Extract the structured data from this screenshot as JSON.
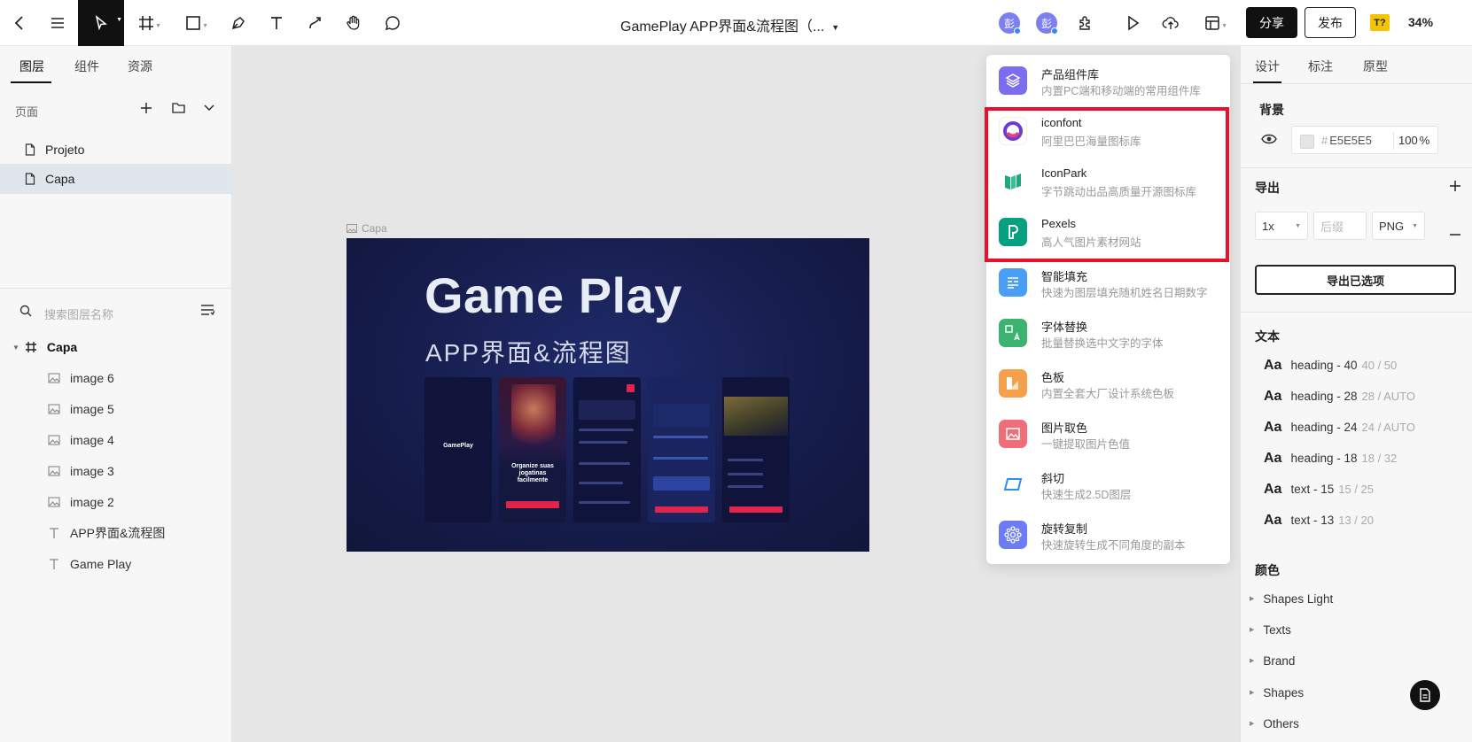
{
  "topbar": {
    "doc_title": "GamePlay APP界面&流程图（...",
    "avatar1": "彭",
    "avatar2": "彭",
    "share_label": "分享",
    "publish_label": "发布",
    "tq_badge": "T?",
    "zoom": "34%"
  },
  "left": {
    "tabs": [
      "图层",
      "组件",
      "资源"
    ],
    "pages_header": "页面",
    "pages": [
      "Projeto",
      "Capa"
    ],
    "search_placeholder": "搜索图层名称",
    "frame_name": "Capa",
    "layers": [
      "image 6",
      "image 5",
      "image 4",
      "image 3",
      "image 2",
      "APP界面&流程图",
      "Game Play"
    ]
  },
  "canvas": {
    "frame_label": "Capa",
    "title": "Game Play",
    "subtitle": "APP界面&流程图",
    "phone1_logo": "GamePlay",
    "phone2_text": "Organize suas jogatinas facilmente"
  },
  "plugins": [
    {
      "name": "产品组件库",
      "desc": "内置PC端和移动端的常用组件库",
      "icon": "layers-icon",
      "color": "#7b6cf0"
    },
    {
      "name": "iconfont",
      "desc": "阿里巴巴海量图标库",
      "icon": "iconfont-icon",
      "color": "#ffffff"
    },
    {
      "name": "IconPark",
      "desc": "字节跳动出品高质量开源图标库",
      "icon": "iconpark-icon",
      "color": "#ffffff"
    },
    {
      "name": "Pexels",
      "desc": "高人气图片素材网站",
      "icon": "pexels-icon",
      "color": "#05a081"
    },
    {
      "name": "智能填充",
      "desc": "快速为图层填充随机姓名日期数字",
      "icon": "fill-icon",
      "color": "#4a9ff5"
    },
    {
      "name": "字体替换",
      "desc": "批量替换选中文字的字体",
      "icon": "font-replace-icon",
      "color": "#3cb371"
    },
    {
      "name": "色板",
      "desc": "内置全套大厂设计系统色板",
      "icon": "palette-icon",
      "color": "#f5a04a"
    },
    {
      "name": "图片取色",
      "desc": "一键提取图片色值",
      "icon": "image-color-icon",
      "color": "#f06e7a"
    },
    {
      "name": "斜切",
      "desc": "快速生成2.5D图层",
      "icon": "skew-icon",
      "color": "#ffffff"
    },
    {
      "name": "旋转复制",
      "desc": "快速旋转生成不同角度的副本",
      "icon": "rotate-copy-icon",
      "color": "#6b7cf5"
    }
  ],
  "right": {
    "tabs": [
      "设计",
      "标注",
      "原型"
    ],
    "bg_title": "背景",
    "bg_hex": "E5E5E5",
    "bg_opacity": "100",
    "bg_pct": "%",
    "export_title": "导出",
    "export_scale": "1x",
    "export_suffix": "后缀",
    "export_format": "PNG",
    "export_button": "导出已选项",
    "text_title": "文本",
    "text_styles": [
      {
        "name": "heading - 40",
        "meta": "40 / 50"
      },
      {
        "name": "heading - 28",
        "meta": "28 / AUTO"
      },
      {
        "name": "heading - 24",
        "meta": "24 / AUTO"
      },
      {
        "name": "heading - 18",
        "meta": "18 / 32"
      },
      {
        "name": "text - 15",
        "meta": "15 / 25"
      },
      {
        "name": "text - 13",
        "meta": "13 / 20"
      }
    ],
    "aa": "Aa",
    "color_title": "颜色",
    "color_groups": [
      "Shapes Light",
      "Texts",
      "Brand",
      "Shapes",
      "Others"
    ]
  }
}
